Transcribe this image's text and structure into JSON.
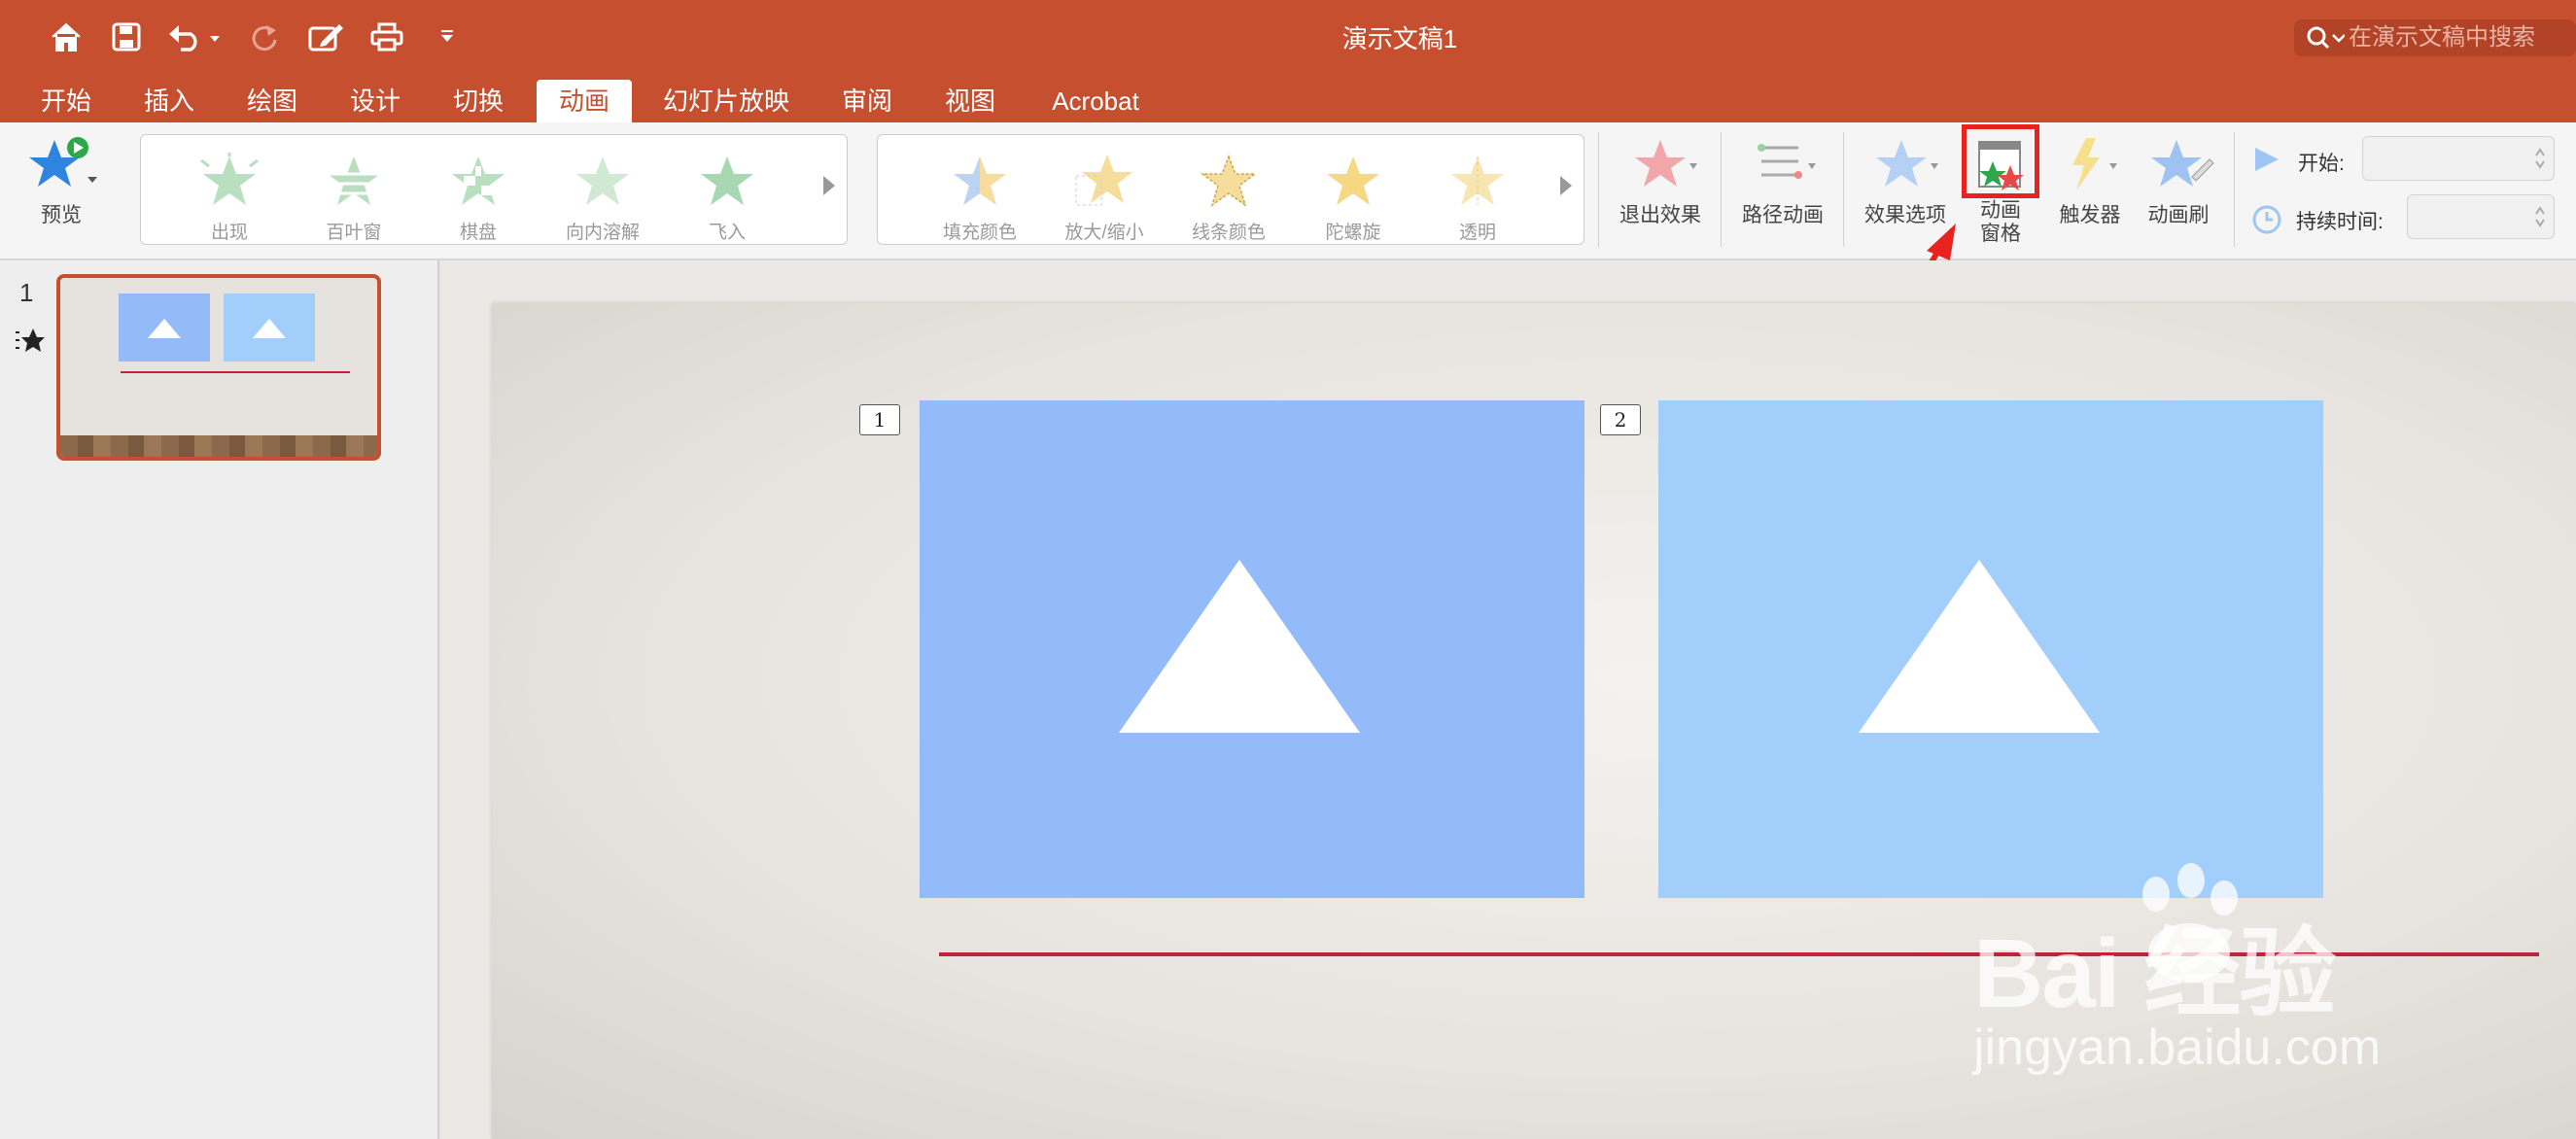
{
  "window": {
    "title": "演示文稿1",
    "search_placeholder": "在演示文稿中搜索"
  },
  "quick_access": [
    "home-icon",
    "save-icon",
    "undo-icon",
    "redo-icon",
    "edit-icon",
    "print-icon",
    "customize-icon"
  ],
  "tabs": [
    {
      "label": "开始",
      "active": false
    },
    {
      "label": "插入",
      "active": false
    },
    {
      "label": "绘图",
      "active": false
    },
    {
      "label": "设计",
      "active": false
    },
    {
      "label": "切换",
      "active": false
    },
    {
      "label": "动画",
      "active": true
    },
    {
      "label": "幻灯片放映",
      "active": false
    },
    {
      "label": "审阅",
      "active": false
    },
    {
      "label": "视图",
      "active": false
    },
    {
      "label": "Acrobat",
      "active": false
    }
  ],
  "ribbon": {
    "preview_label": "预览",
    "entrance_effects": [
      "出现",
      "百叶窗",
      "棋盘",
      "向内溶解",
      "飞入"
    ],
    "emphasis_effects": [
      "填充颜色",
      "放大/缩小",
      "线条颜色",
      "陀螺旋",
      "透明"
    ],
    "exit_effects_label": "退出效果",
    "path_animation_label": "路径动画",
    "effect_options_label": "效果选项",
    "animation_pane_label_line1": "动画",
    "animation_pane_label_line2": "窗格",
    "trigger_label": "触发器",
    "animation_painter_label": "动画刷",
    "start_label": "开始:",
    "duration_label": "持续时间:"
  },
  "slides_pane": {
    "slide_number": "1"
  },
  "slide": {
    "badge1": "1",
    "badge2": "2"
  },
  "watermark": {
    "brand": "Bai 经验",
    "url": "jingyan.baidu.com"
  },
  "colors": {
    "accent": "#c64f2f",
    "box1": "#93bbf9",
    "box2": "#a2cefb",
    "line": "#c4213c",
    "highlight": "#e8231f"
  }
}
